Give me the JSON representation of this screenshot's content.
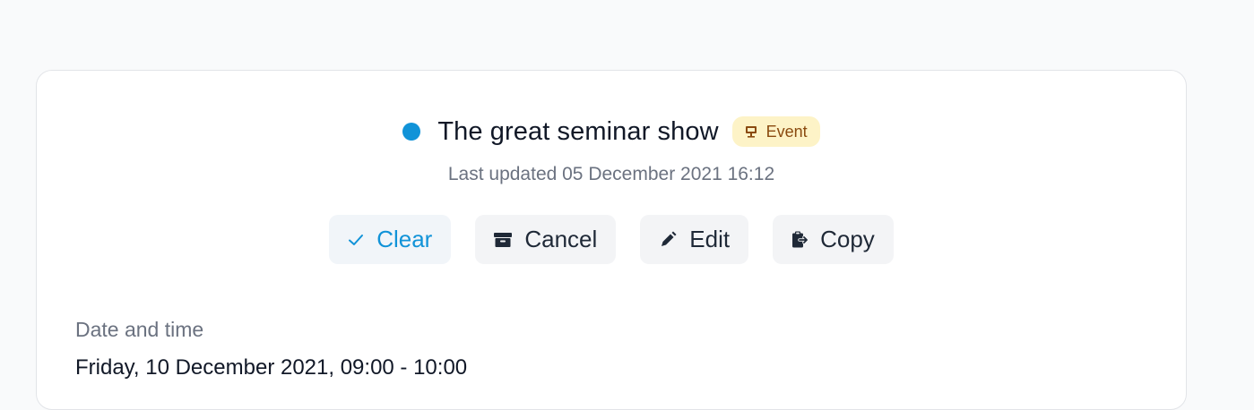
{
  "event": {
    "title": "The great seminar show",
    "status_color": "#1193d8",
    "badge": {
      "label": "Event",
      "icon": "presentation-icon",
      "bg": "#fdf3c7",
      "color": "#8a4a0f"
    },
    "last_updated": "Last updated 05 December 2021 16:12"
  },
  "actions": [
    {
      "label": "Clear",
      "icon": "check-icon",
      "color": "#1193d8"
    },
    {
      "label": "Cancel",
      "icon": "archive-icon"
    },
    {
      "label": "Edit",
      "icon": "pencil-icon"
    },
    {
      "label": "Copy",
      "icon": "clipboard-icon"
    }
  ],
  "details": {
    "date_label": "Date and time",
    "date_value": "Friday, 10 December 2021, 09:00 - 10:00"
  }
}
